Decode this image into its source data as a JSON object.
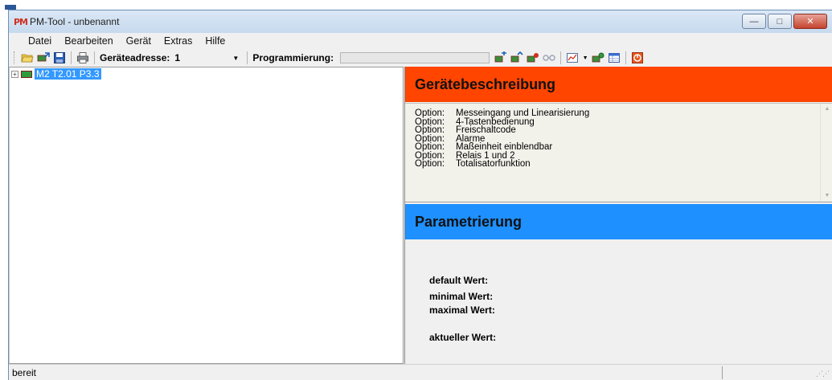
{
  "window": {
    "title": "PM-Tool - unbenannt",
    "logo_text": "PM",
    "controls": {
      "minimize": "—",
      "maximize": "□",
      "close": "✕"
    }
  },
  "menu": {
    "items": [
      "Datei",
      "Bearbeiten",
      "Gerät",
      "Extras",
      "Hilfe"
    ]
  },
  "toolbar": {
    "address_label": "Geräteadresse:",
    "address_value": "1",
    "programming_label": "Programmierung:",
    "progress_fraction": 0,
    "icons_left": [
      "open-folder-icon",
      "device-read-icon",
      "save-icon",
      "print-icon"
    ],
    "icons_right": [
      "device-transfer-icon",
      "device-compare-icon",
      "device-write-icon",
      "connection-icon",
      "chart-icon",
      "device-settings-icon",
      "table-icon",
      "info-icon"
    ]
  },
  "tree": {
    "expander": "+",
    "node_label": "M2 T2.01 P3.3"
  },
  "description": {
    "header": "Gerätebeschreibung",
    "option_prefix": "Option:",
    "options": [
      "Messeingang und Linearisierung",
      "4-Tastenbedienung",
      "Freischaltcode",
      "Alarme",
      "Maßeinheit einblendbar",
      "Relais 1 und 2",
      "Totalisatorfunktion"
    ]
  },
  "parameters": {
    "header": "Parametrierung",
    "default_label": "default Wert:",
    "min_label": "minimal Wert:",
    "max_label": "maximal Wert:",
    "current_label": "aktueller Wert:"
  },
  "status": {
    "text": "bereit"
  },
  "colors": {
    "description_header": "#ff4500",
    "parameter_header": "#1e90ff",
    "tree_selection": "#3399ff"
  }
}
